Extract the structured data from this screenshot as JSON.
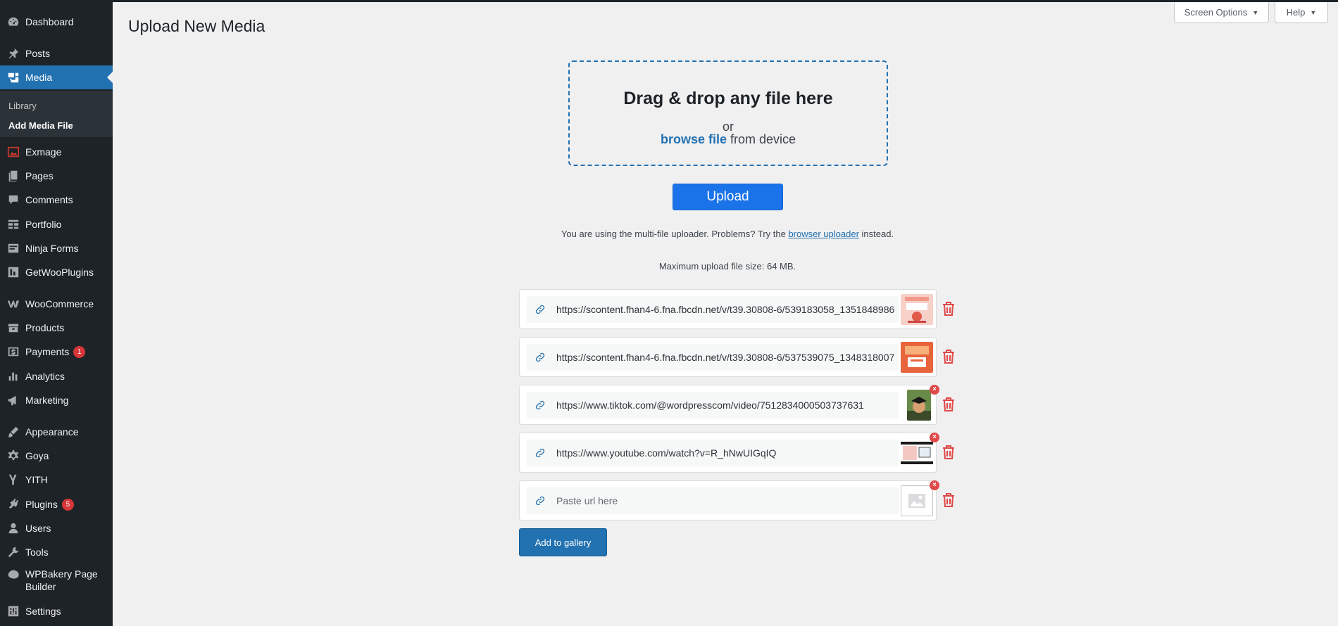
{
  "sidebar": {
    "items": [
      {
        "label": "Dashboard",
        "icon": "dashboard-icon"
      },
      {
        "label": "Posts",
        "icon": "pin-icon"
      },
      {
        "label": "Media",
        "icon": "media-icon"
      },
      {
        "label": "Exmage",
        "icon": "exmage-icon"
      },
      {
        "label": "Pages",
        "icon": "pages-icon"
      },
      {
        "label": "Comments",
        "icon": "comment-icon"
      },
      {
        "label": "Portfolio",
        "icon": "portfolio-icon"
      },
      {
        "label": "Ninja Forms",
        "icon": "forms-icon"
      },
      {
        "label": "GetWooPlugins",
        "icon": "plugin-box-icon"
      },
      {
        "label": "WooCommerce",
        "icon": "woocommerce-icon"
      },
      {
        "label": "Products",
        "icon": "products-icon"
      },
      {
        "label": "Payments",
        "icon": "payments-icon",
        "badge": "1"
      },
      {
        "label": "Analytics",
        "icon": "analytics-icon"
      },
      {
        "label": "Marketing",
        "icon": "megaphone-icon"
      },
      {
        "label": "Appearance",
        "icon": "brush-icon"
      },
      {
        "label": "Goya",
        "icon": "gear-icon"
      },
      {
        "label": "YITH",
        "icon": "yith-icon"
      },
      {
        "label": "Plugins",
        "icon": "plugins-icon",
        "badge": "5"
      },
      {
        "label": "Users",
        "icon": "user-icon"
      },
      {
        "label": "Tools",
        "icon": "wrench-icon"
      },
      {
        "label": "WPBakery Page Builder",
        "icon": "wpbakery-icon"
      },
      {
        "label": "Settings",
        "icon": "settings-icon"
      }
    ],
    "submenu": {
      "library": "Library",
      "add_media": "Add Media File"
    }
  },
  "header": {
    "title": "Upload New Media",
    "screen_options": "Screen Options",
    "help": "Help"
  },
  "dropzone": {
    "title": "Drag & drop any file here",
    "or": "or",
    "browse": "browse file",
    "from_device": " from device"
  },
  "upload_button": "Upload",
  "info": {
    "uploader_prefix": "You are using the multi-file uploader. Problems? Try the ",
    "uploader_link": "browser uploader",
    "uploader_suffix": " instead.",
    "max_size": "Maximum upload file size: 64 MB."
  },
  "url_rows": [
    {
      "value": "https://scontent.fhan4-6.fna.fbcdn.net/v/t39.30808-6/539183058_1351848986"
    },
    {
      "value": "https://scontent.fhan4-6.fna.fbcdn.net/v/t39.30808-6/537539075_1348318007"
    },
    {
      "value": "https://www.tiktok.com/@wordpresscom/video/7512834000503737631"
    },
    {
      "value": "https://www.youtube.com/watch?v=R_hNwUIGqIQ"
    },
    {
      "value": "",
      "placeholder": "Paste url here"
    }
  ],
  "add_to_gallery": "Add to gallery",
  "colors": {
    "sidebar_bg": "#1d2327",
    "accent": "#2271b1",
    "upload_blue": "#1a73e8",
    "danger": "#e04848"
  }
}
